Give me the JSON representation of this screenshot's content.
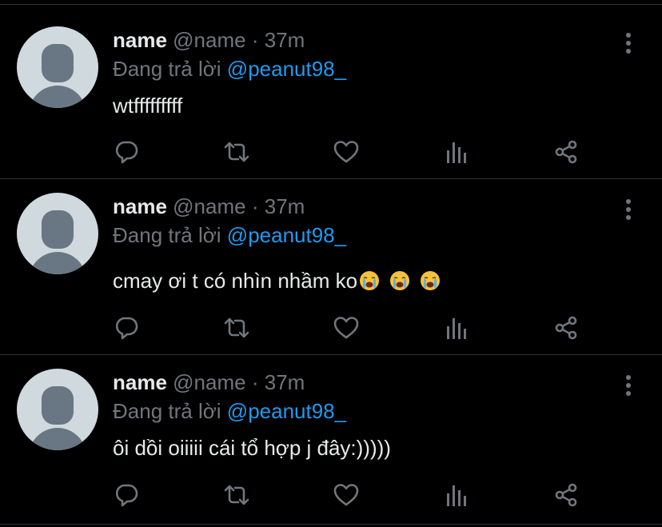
{
  "tweets": [
    {
      "display_name": "name",
      "handle": "@name",
      "separator": "·",
      "time": "37m",
      "reply_prefix": "Đang trả lời",
      "reply_mention": "@peanut98_",
      "text": "wtfffffffff",
      "emoji_count": 0
    },
    {
      "display_name": "name",
      "handle": "@name",
      "separator": "·",
      "time": "37m",
      "reply_prefix": "Đang trả lời",
      "reply_mention": "@peanut98_",
      "text": "cmay ơi t có nhìn nhầm ko",
      "emoji_count": 3
    },
    {
      "display_name": "name",
      "handle": "@name",
      "separator": "·",
      "time": "37m",
      "reply_prefix": "Đang trả lời",
      "reply_mention": "@peanut98_",
      "text": "ôi dồi oiiiii cái tổ hợp j đây:)))))",
      "emoji_count": 0
    }
  ],
  "icons": {
    "reply": "reply-icon",
    "retweet": "retweet-icon",
    "like": "heart-icon",
    "analytics": "analytics-icon",
    "share": "share-icon",
    "more": "more-options-icon",
    "emoji": "loudly-crying-face-emoji"
  },
  "colors": {
    "background": "#000000",
    "text_primary": "#e7e9ea",
    "text_secondary": "#71767b",
    "link": "#1d9bf0",
    "divider": "#2f3336",
    "avatar_bg": "#cfd9de",
    "avatar_fg": "#687783"
  }
}
